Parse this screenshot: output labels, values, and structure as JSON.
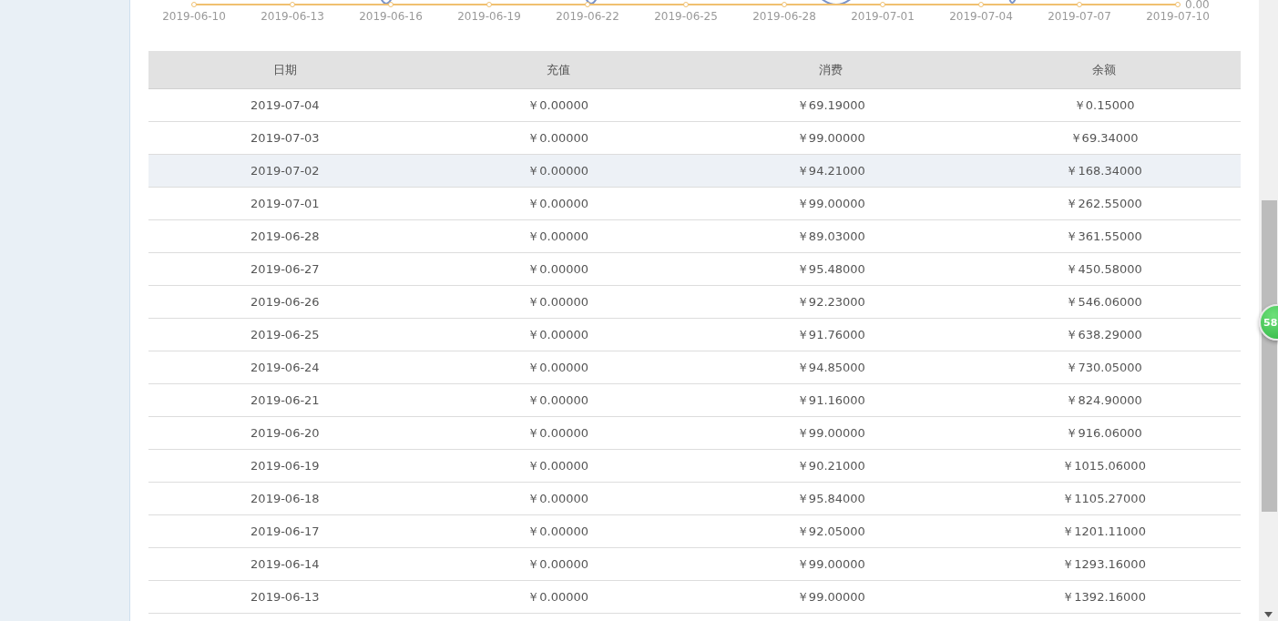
{
  "chart": {
    "x_labels": [
      "2019-06-10",
      "2019-06-13",
      "2019-06-16",
      "2019-06-19",
      "2019-06-22",
      "2019-06-25",
      "2019-06-28",
      "2019-07-01",
      "2019-07-04",
      "2019-07-07",
      "2019-07-10"
    ],
    "y_label": "0.00"
  },
  "table": {
    "columns": [
      "日期",
      "充值",
      "消费",
      "余额"
    ],
    "rows": [
      {
        "cells": [
          "2019-07-04",
          "￥0.00000",
          "￥69.19000",
          "￥0.15000"
        ],
        "highlighted": false
      },
      {
        "cells": [
          "2019-07-03",
          "￥0.00000",
          "￥99.00000",
          "￥69.34000"
        ],
        "highlighted": false
      },
      {
        "cells": [
          "2019-07-02",
          "￥0.00000",
          "￥94.21000",
          "￥168.34000"
        ],
        "highlighted": true
      },
      {
        "cells": [
          "2019-07-01",
          "￥0.00000",
          "￥99.00000",
          "￥262.55000"
        ],
        "highlighted": false
      },
      {
        "cells": [
          "2019-06-28",
          "￥0.00000",
          "￥89.03000",
          "￥361.55000"
        ],
        "highlighted": false
      },
      {
        "cells": [
          "2019-06-27",
          "￥0.00000",
          "￥95.48000",
          "￥450.58000"
        ],
        "highlighted": false
      },
      {
        "cells": [
          "2019-06-26",
          "￥0.00000",
          "￥92.23000",
          "￥546.06000"
        ],
        "highlighted": false
      },
      {
        "cells": [
          "2019-06-25",
          "￥0.00000",
          "￥91.76000",
          "￥638.29000"
        ],
        "highlighted": false
      },
      {
        "cells": [
          "2019-06-24",
          "￥0.00000",
          "￥94.85000",
          "￥730.05000"
        ],
        "highlighted": false
      },
      {
        "cells": [
          "2019-06-21",
          "￥0.00000",
          "￥91.16000",
          "￥824.90000"
        ],
        "highlighted": false
      },
      {
        "cells": [
          "2019-06-20",
          "￥0.00000",
          "￥99.00000",
          "￥916.06000"
        ],
        "highlighted": false
      },
      {
        "cells": [
          "2019-06-19",
          "￥0.00000",
          "￥90.21000",
          "￥1015.06000"
        ],
        "highlighted": false
      },
      {
        "cells": [
          "2019-06-18",
          "￥0.00000",
          "￥95.84000",
          "￥1105.27000"
        ],
        "highlighted": false
      },
      {
        "cells": [
          "2019-06-17",
          "￥0.00000",
          "￥92.05000",
          "￥1201.11000"
        ],
        "highlighted": false
      },
      {
        "cells": [
          "2019-06-14",
          "￥0.00000",
          "￥99.00000",
          "￥1293.16000"
        ],
        "highlighted": false
      },
      {
        "cells": [
          "2019-06-13",
          "￥0.00000",
          "￥99.00000",
          "￥1392.16000"
        ],
        "highlighted": false
      }
    ]
  },
  "floating_badge": {
    "text": "58"
  }
}
